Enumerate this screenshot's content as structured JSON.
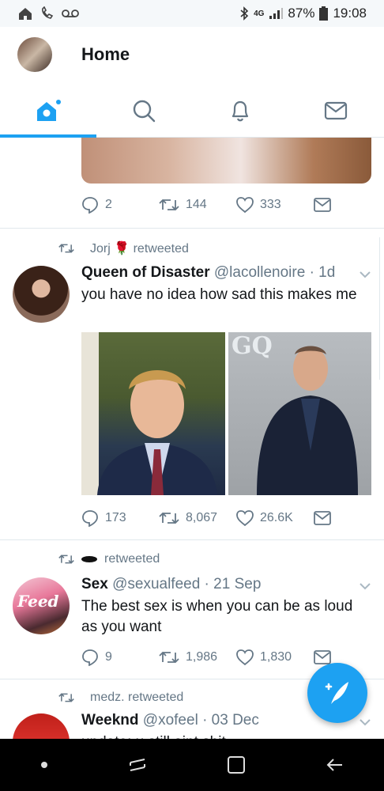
{
  "status_bar": {
    "network": "4G",
    "battery": "87%",
    "time": "19:08"
  },
  "header": {
    "title": "Home"
  },
  "tabs": [
    {
      "name": "home-icon"
    },
    {
      "name": "search-icon"
    },
    {
      "name": "notifications-icon"
    },
    {
      "name": "messages-icon"
    }
  ],
  "tweets": [
    {
      "counts": {
        "replies": "2",
        "retweets": "144",
        "likes": "333"
      }
    },
    {
      "retweeted_by": "Jorj 🌹 retweeted",
      "name": "Queen of Disaster",
      "handle_time": "@lacollenoire · 1d",
      "text": "you have no idea how sad this makes me",
      "photo_badge": "GQ",
      "counts": {
        "replies": "173",
        "retweets": "8,067",
        "likes": "26.6K"
      }
    },
    {
      "retweeted_by": "retweeted",
      "name": "Sex",
      "handle_time": "@sexualfeed · 21 Sep",
      "text": "The best sex is when you can be as loud as you want",
      "avatar_label": "Feed",
      "counts": {
        "replies": "9",
        "retweets": "1,986",
        "likes": "1,830"
      }
    },
    {
      "retweeted_by": "medz. retweeted",
      "name": "Weeknd",
      "handle_time": "@xofeel · 03 Dec",
      "text": "update: u still aint shit"
    }
  ],
  "colors": {
    "accent": "#1da1f2",
    "meta": "#657786"
  }
}
